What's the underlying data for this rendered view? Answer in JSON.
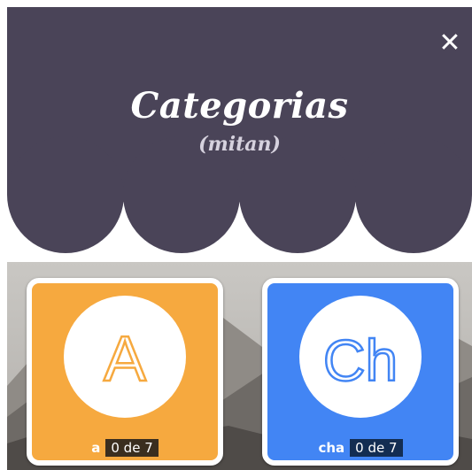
{
  "header": {
    "title": "Categorias",
    "subtitle": "(mitan)"
  },
  "close": {
    "label": "✕"
  },
  "colors": {
    "header": "#4a4458",
    "card_a": "#f6a93f",
    "card_ch": "#4285f4"
  },
  "categories": [
    {
      "glyph": "A",
      "label": "a",
      "progress": "0 de 7"
    },
    {
      "glyph": "Ch",
      "label": "cha",
      "progress": "0 de 7"
    }
  ]
}
